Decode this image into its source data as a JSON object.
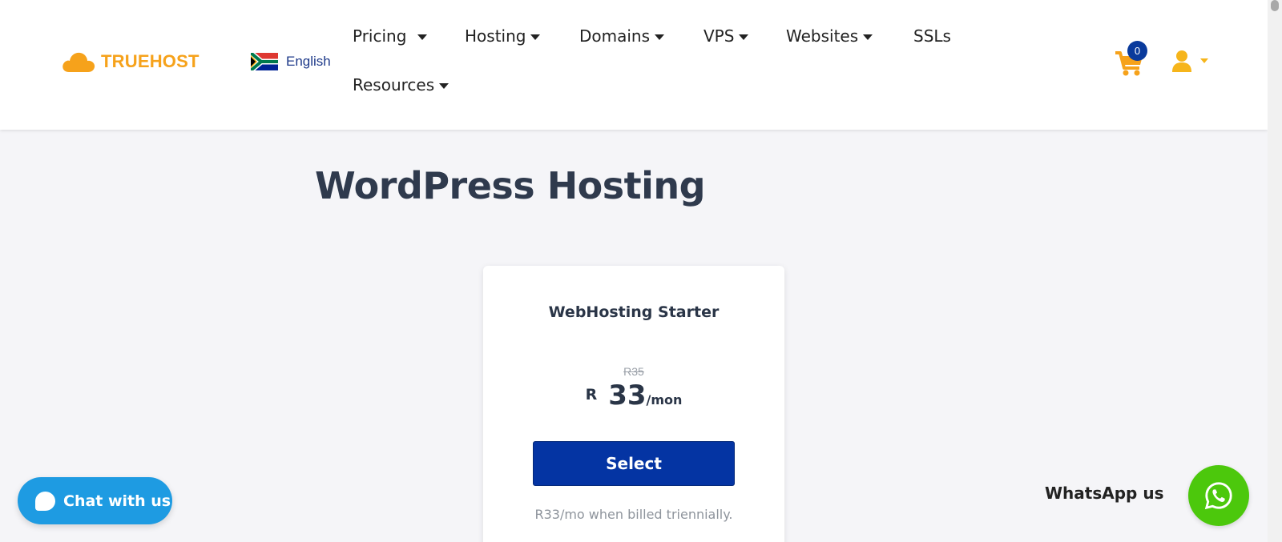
{
  "brand": {
    "name": "TRUEHOST",
    "accent": "#f6a21b",
    "primary": "#0434a3"
  },
  "language": {
    "label": "English",
    "flag_icon": "south-africa-flag-icon"
  },
  "nav": {
    "items": [
      {
        "label": "Pricing",
        "has_dropdown": true
      },
      {
        "label": "Hosting",
        "has_dropdown": true
      },
      {
        "label": "Domains",
        "has_dropdown": true
      },
      {
        "label": "VPS",
        "has_dropdown": true
      },
      {
        "label": "Websites",
        "has_dropdown": true
      },
      {
        "label": "SSLs",
        "has_dropdown": false
      },
      {
        "label": "Resources",
        "has_dropdown": true
      }
    ]
  },
  "cart": {
    "count": "0",
    "icon": "shopping-cart-icon"
  },
  "account": {
    "icon": "user-icon"
  },
  "page": {
    "title": "WordPress Hosting"
  },
  "plan": {
    "name": "WebHosting Starter",
    "old_price": "R35",
    "currency": "R",
    "amount": "33",
    "period": "/mon",
    "select_label": "Select",
    "billing_note": "R33/mo when billed triennially."
  },
  "chat": {
    "label": "Chat with us",
    "color": "#1e9be2"
  },
  "whatsapp": {
    "label": "WhatsApp us",
    "color": "#4cc80c",
    "icon": "whatsapp-icon"
  }
}
